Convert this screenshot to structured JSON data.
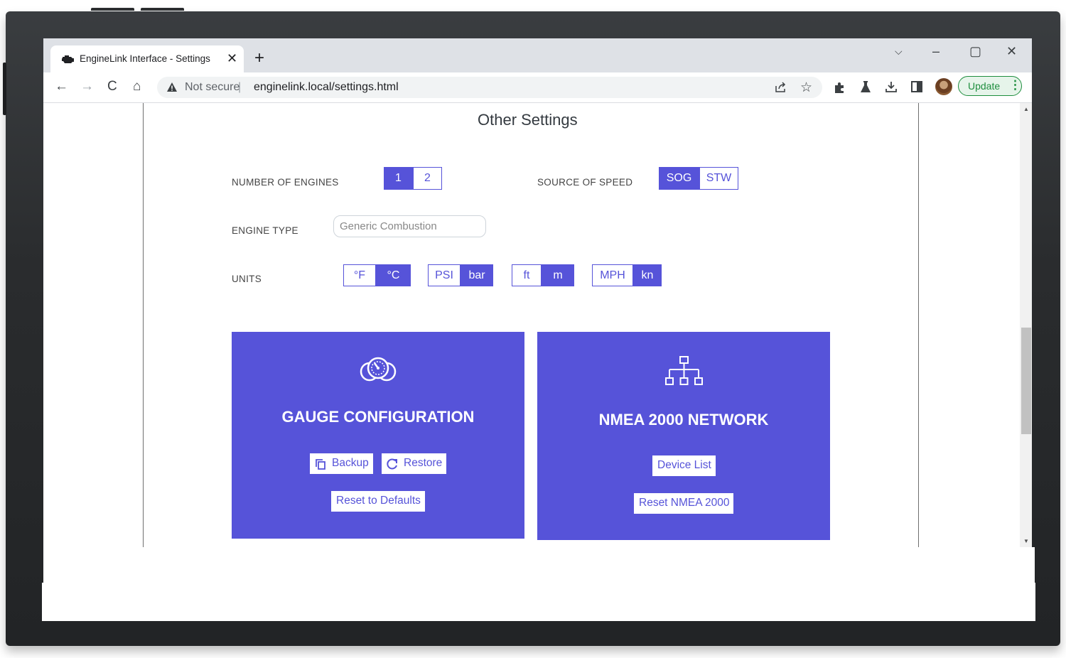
{
  "browser": {
    "tab_title": "EngineLink Interface - Settings",
    "tab_close": "✕",
    "new_tab": "+",
    "window_controls": {
      "dropdown": "⌵",
      "minimize": "–",
      "maximize": "▢",
      "close": "✕"
    },
    "nav": {
      "back": "←",
      "forward": "→",
      "reload": "C",
      "home": "⌂"
    },
    "security_label": "Not secure",
    "separator": "|",
    "url": "enginelink.local/settings.html",
    "toolbar_icons": [
      "share-icon",
      "star-icon",
      "extensions-icon",
      "labs-icon",
      "download-icon",
      "sidepanel-icon"
    ],
    "update_label": "Update",
    "menu_dots": "⋮"
  },
  "page": {
    "heading": "Other Settings",
    "engines": {
      "label": "NUMBER OF ENGINES",
      "options": [
        "1",
        "2"
      ],
      "selected": "1"
    },
    "speed": {
      "label": "SOURCE OF SPEED",
      "options": [
        "SOG",
        "STW"
      ],
      "selected": "SOG"
    },
    "engine_type": {
      "label": "ENGINE TYPE",
      "value": "Generic Combustion"
    },
    "units": {
      "label": "UNITS",
      "temperature": {
        "options": [
          "°F",
          "°C"
        ],
        "selected": "°C"
      },
      "pressure": {
        "options": [
          "PSI",
          "bar"
        ],
        "selected": "bar"
      },
      "depth": {
        "options": [
          "ft",
          "m"
        ],
        "selected": "m"
      },
      "speed": {
        "options": [
          "MPH",
          "kn"
        ],
        "selected": "kn"
      }
    },
    "gauge_card": {
      "title": "GAUGE CONFIGURATION",
      "icon": "gauge-icon",
      "backup_label": "Backup",
      "restore_label": "Restore",
      "reset_label": "Reset to Defaults"
    },
    "nmea_card": {
      "title": "NMEA 2000 NETWORK",
      "icon": "network-icon",
      "device_list_label": "Device List",
      "reset_label": "Reset NMEA 2000"
    }
  },
  "colors": {
    "accent": "#5653d9",
    "chrome": "#dee1e6",
    "update_green": "#1e8e3e"
  }
}
